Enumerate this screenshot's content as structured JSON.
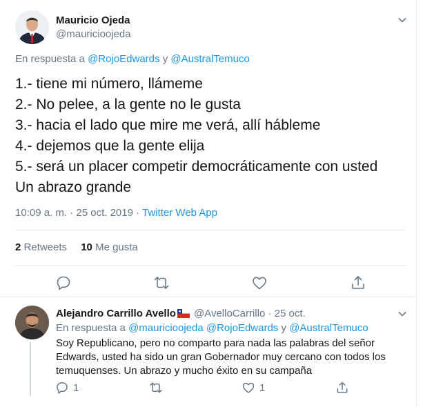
{
  "tweet": {
    "author_name": "Mauricio Ojeda",
    "author_handle": "@mauricioojeda",
    "reply_prefix": "En respuesta a",
    "reply_mention_1": "@RojoEdwards",
    "reply_join": "y",
    "reply_mention_2": "@AustralTemuco",
    "lines": [
      "1.- tiene mi número, llámeme",
      "2.- No pelee, a la gente no le gusta",
      "3.- hacia el lado que mire me verá, allí hábleme",
      "4.- dejemos que la gente elija",
      "5.- será un placer competir democráticamente con usted",
      "Un abrazo grande"
    ],
    "time": "10:09 a. m.",
    "dot": "·",
    "date": "25 oct. 2019",
    "source": "Twitter Web App",
    "retweets_count": "2",
    "retweets_label": "Retweets",
    "likes_count": "10",
    "likes_label": "Me gusta"
  },
  "reply": {
    "author_name": "Alejandro Carrillo Avello",
    "author_handle": "@AvelloCarrillo",
    "dot": "·",
    "date": "25 oct.",
    "reply_prefix": "En respuesta a",
    "mention_1": "@mauricioojeda",
    "mention_2": "@RojoEdwards",
    "reply_join": "y",
    "mention_3": "@AustralTemuco",
    "lines": [
      "Soy Republicano, pero no comparto para nada las palabras del señor",
      "Edwards, usted ha sido un gran Gobernador muy cercano con todos los",
      "temuquenses.  Un abrazo y mucho éxito en su campaña"
    ],
    "reply_count": "1",
    "like_count": "1"
  },
  "colors": {
    "text": "#14171a",
    "muted": "#657786",
    "link": "#1b95e0",
    "border": "#e6ecf0",
    "icon": "#657786"
  },
  "icons": [
    "caret-down-icon",
    "reply-icon",
    "retweet-icon",
    "like-icon",
    "share-icon",
    "chile-flag-icon"
  ]
}
